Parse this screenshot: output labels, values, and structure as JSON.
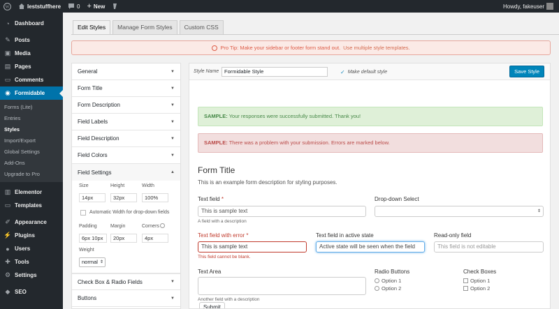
{
  "admin_bar": {
    "site_name": "Ieststuffhere",
    "comments_count": "0",
    "new_label": "New",
    "greeting": "Howdy, fakeuser"
  },
  "sidebar": {
    "items_top": [
      {
        "label": "Dashboard",
        "icon": "dashboard-icon"
      },
      {
        "label": "Posts",
        "icon": "pin-icon"
      },
      {
        "label": "Media",
        "icon": "media-icon"
      },
      {
        "label": "Pages",
        "icon": "page-icon"
      },
      {
        "label": "Comments",
        "icon": "comment-icon"
      }
    ],
    "active": {
      "label": "Formidable",
      "icon": "formidable-icon"
    },
    "submenu": [
      "Forms (Lite)",
      "Entries",
      "Styles",
      "Import/Export",
      "Global Settings",
      "Add-Ons",
      "Upgrade to Pro"
    ],
    "items_bottom": [
      {
        "label": "Elementor",
        "icon": "elementor-icon"
      },
      {
        "label": "Templates",
        "icon": "folder-icon"
      },
      {
        "label": "Appearance",
        "icon": "brush-icon"
      },
      {
        "label": "Plugins",
        "icon": "plug-icon"
      },
      {
        "label": "Users",
        "icon": "user-icon"
      },
      {
        "label": "Tools",
        "icon": "wrench-icon"
      },
      {
        "label": "Settings",
        "icon": "settings-icon"
      },
      {
        "label": "SEO",
        "icon": "seo-icon"
      }
    ]
  },
  "tabs": [
    "Edit Styles",
    "Manage Form Styles",
    "Custom CSS"
  ],
  "protip": {
    "text": "Pro Tip: Make your sidebar or footer form stand out.",
    "link": "Use multiple style templates."
  },
  "left_panel": {
    "sections_top": [
      "General",
      "Form Title",
      "Form Description",
      "Field Labels",
      "Field Description",
      "Field Colors"
    ],
    "field_settings": {
      "title": "Field Settings",
      "size_label": "Size",
      "size_value": "14px",
      "height_label": "Height",
      "height_value": "32px",
      "width_label": "Width",
      "width_value": "100%",
      "auto_width_label": "Automatic Width for drop-down fields",
      "padding_label": "Padding",
      "padding_value": "6px 10px",
      "margin_label": "Margin",
      "margin_value": "20px",
      "corners_label": "Corners",
      "corners_value": "4px",
      "weight_label": "Weight",
      "weight_value": "normal"
    },
    "sections_bottom": [
      "Check Box & Radio Fields",
      "Buttons"
    ]
  },
  "right_panel": {
    "style_name_label": "Style Name",
    "style_name_value": "Formidable Style",
    "default_label": "Make default style",
    "save_label": "Save Style",
    "sample_success_strong": "SAMPLE:",
    "sample_success": "Your responses were successfully submitted. Thank you!",
    "sample_error_strong": "SAMPLE:",
    "sample_error": "There was a problem with your submission. Errors are marked below.",
    "form_title": "Form Title",
    "form_desc": "This is an example form description for styling purposes.",
    "text_field": {
      "label": "Text field",
      "value": "This is sample text",
      "help": "A field with a description"
    },
    "dropdown": {
      "label": "Drop-down Select"
    },
    "error_field": {
      "label": "Text field with error",
      "value": "This is sample text",
      "error": "This field cannot be blank."
    },
    "active_field": {
      "label": "Text field in active state",
      "value": "Active state will be seen when the field"
    },
    "readonly_field": {
      "label": "Read-only field",
      "value": "This field is not editable"
    },
    "textarea": {
      "label": "Text Area",
      "help": "Another field with a description"
    },
    "radio": {
      "label": "Radio Buttons",
      "options": [
        "Option 1",
        "Option 2"
      ]
    },
    "check": {
      "label": "Check Boxes",
      "options": [
        "Option 1",
        "Option 2"
      ]
    },
    "submit_label": "Submit",
    "required_mark": "*"
  }
}
